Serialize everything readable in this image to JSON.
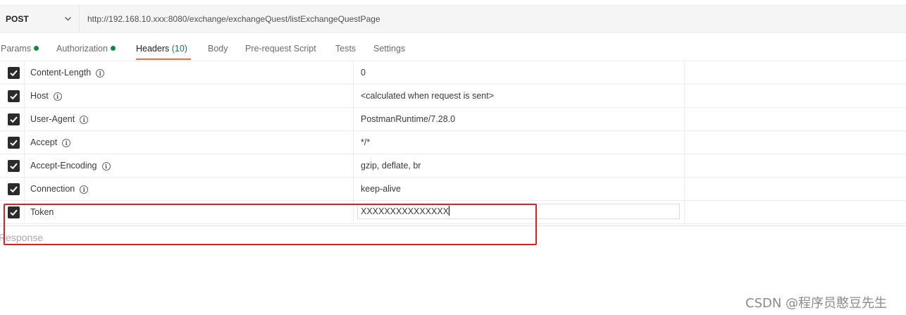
{
  "request": {
    "method": "POST",
    "url": "http://192.168.10.xxx:8080/exchange/exchangeQuest/listExchangeQuestPage"
  },
  "tabs": [
    {
      "label": "Params",
      "dot": true
    },
    {
      "label": "Authorization",
      "dot": true
    },
    {
      "label": "Headers",
      "count": "(10)",
      "active": true
    },
    {
      "label": "Body"
    },
    {
      "label": "Pre-request Script"
    },
    {
      "label": "Tests"
    },
    {
      "label": "Settings"
    }
  ],
  "headers": [
    {
      "key": "Content-Length",
      "value": "0",
      "checked": true,
      "info": true
    },
    {
      "key": "Host",
      "value": "<calculated when request is sent>",
      "checked": true,
      "info": true
    },
    {
      "key": "User-Agent",
      "value": "PostmanRuntime/7.28.0",
      "checked": true,
      "info": true
    },
    {
      "key": "Accept",
      "value": "*/*",
      "checked": true,
      "info": true
    },
    {
      "key": "Accept-Encoding",
      "value": "gzip, deflate, br",
      "checked": true,
      "info": true
    },
    {
      "key": "Connection",
      "value": "keep-alive",
      "checked": true,
      "info": true
    },
    {
      "key": "Token",
      "value": "XXXXXXXXXXXXXXX",
      "checked": true,
      "info": false
    }
  ],
  "response_label": "Response",
  "watermark": "CSDN @程序员憨豆先生",
  "colors": {
    "accent": "#f26b3a",
    "status_dot": "#0c8a3e",
    "highlight": "#e02020"
  }
}
